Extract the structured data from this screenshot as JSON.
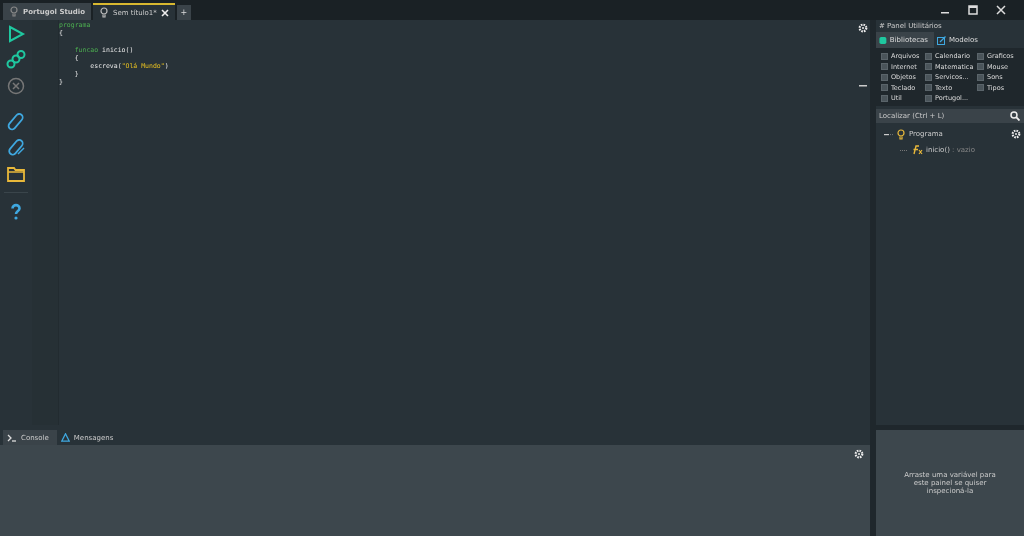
{
  "tabs": [
    {
      "label": "Portugol Studio",
      "selected": false,
      "kind": "home"
    },
    {
      "label": "Sem título1*",
      "selected": true,
      "kind": "file",
      "closable": true
    }
  ],
  "new_tab": "+",
  "toolbar": [
    {
      "kind": "run"
    },
    {
      "kind": "debug"
    },
    {
      "kind": "stop",
      "disabled": true
    },
    {
      "kind": "save"
    },
    {
      "kind": "save-as"
    },
    {
      "kind": "open"
    },
    {
      "kind": "help"
    }
  ],
  "code": [
    [
      {
        "text": "programa",
        "kind": "keyword"
      }
    ],
    [
      {
        "text": "{",
        "kind": "plain"
      }
    ],
    {
      "kind": "blank"
    },
    [
      {
        "text": "    funcao",
        "kind": "keyword"
      },
      {
        "text": " inicio()",
        "kind": "plain"
      }
    ],
    [
      {
        "text": "    {",
        "kind": "plain"
      }
    ],
    [
      {
        "text": "        escreva(",
        "kind": "plain"
      },
      {
        "text": "\"Olá Mundo\"",
        "kind": "string"
      },
      {
        "text": ")",
        "kind": "plain"
      }
    ],
    [
      {
        "text": "    }",
        "kind": "plain"
      }
    ],
    [
      {
        "text": "}",
        "kind": "plain"
      }
    ]
  ],
  "panel": {
    "title": "# Panel Utilitários",
    "tabs": [
      {
        "label": "Bibliotecas",
        "selected": true,
        "kind": "libs"
      },
      {
        "label": "Modelos",
        "selected": false,
        "kind": "models"
      }
    ],
    "libraries": [
      {
        "label": "Arquivos",
        "checked": false
      },
      {
        "label": "Calendario",
        "checked": false
      },
      {
        "label": "Graficos",
        "checked": false
      },
      {
        "label": "Internet",
        "checked": false
      },
      {
        "label": "Matematica",
        "checked": false
      },
      {
        "label": "Mouse",
        "checked": false
      },
      {
        "label": "Objetos",
        "checked": false
      },
      {
        "label": "Servicos...",
        "checked": false
      },
      {
        "label": "Sons",
        "checked": false
      },
      {
        "label": "Teclado",
        "checked": false
      },
      {
        "label": "Texto",
        "checked": false
      },
      {
        "label": "Tipos",
        "checked": false
      },
      {
        "label": "Util",
        "checked": false
      },
      {
        "label": "Portugol...",
        "checked": false
      }
    ],
    "search": {
      "placeholder": "Localizar (Ctrl + L)"
    },
    "tree": [
      {
        "label": "Programa",
        "expanded": true,
        "children": [
          {
            "label": "inicio()",
            "type": " : vazio"
          }
        ]
      }
    ]
  },
  "bottom_tabs": [
    {
      "label": "Console",
      "selected": true,
      "kind": "console"
    },
    {
      "label": "Mensagens",
      "selected": false,
      "kind": "messages"
    }
  ],
  "inspector": {
    "hint": "Arraste uma variável para este painel se quiser inspecioná-la"
  }
}
